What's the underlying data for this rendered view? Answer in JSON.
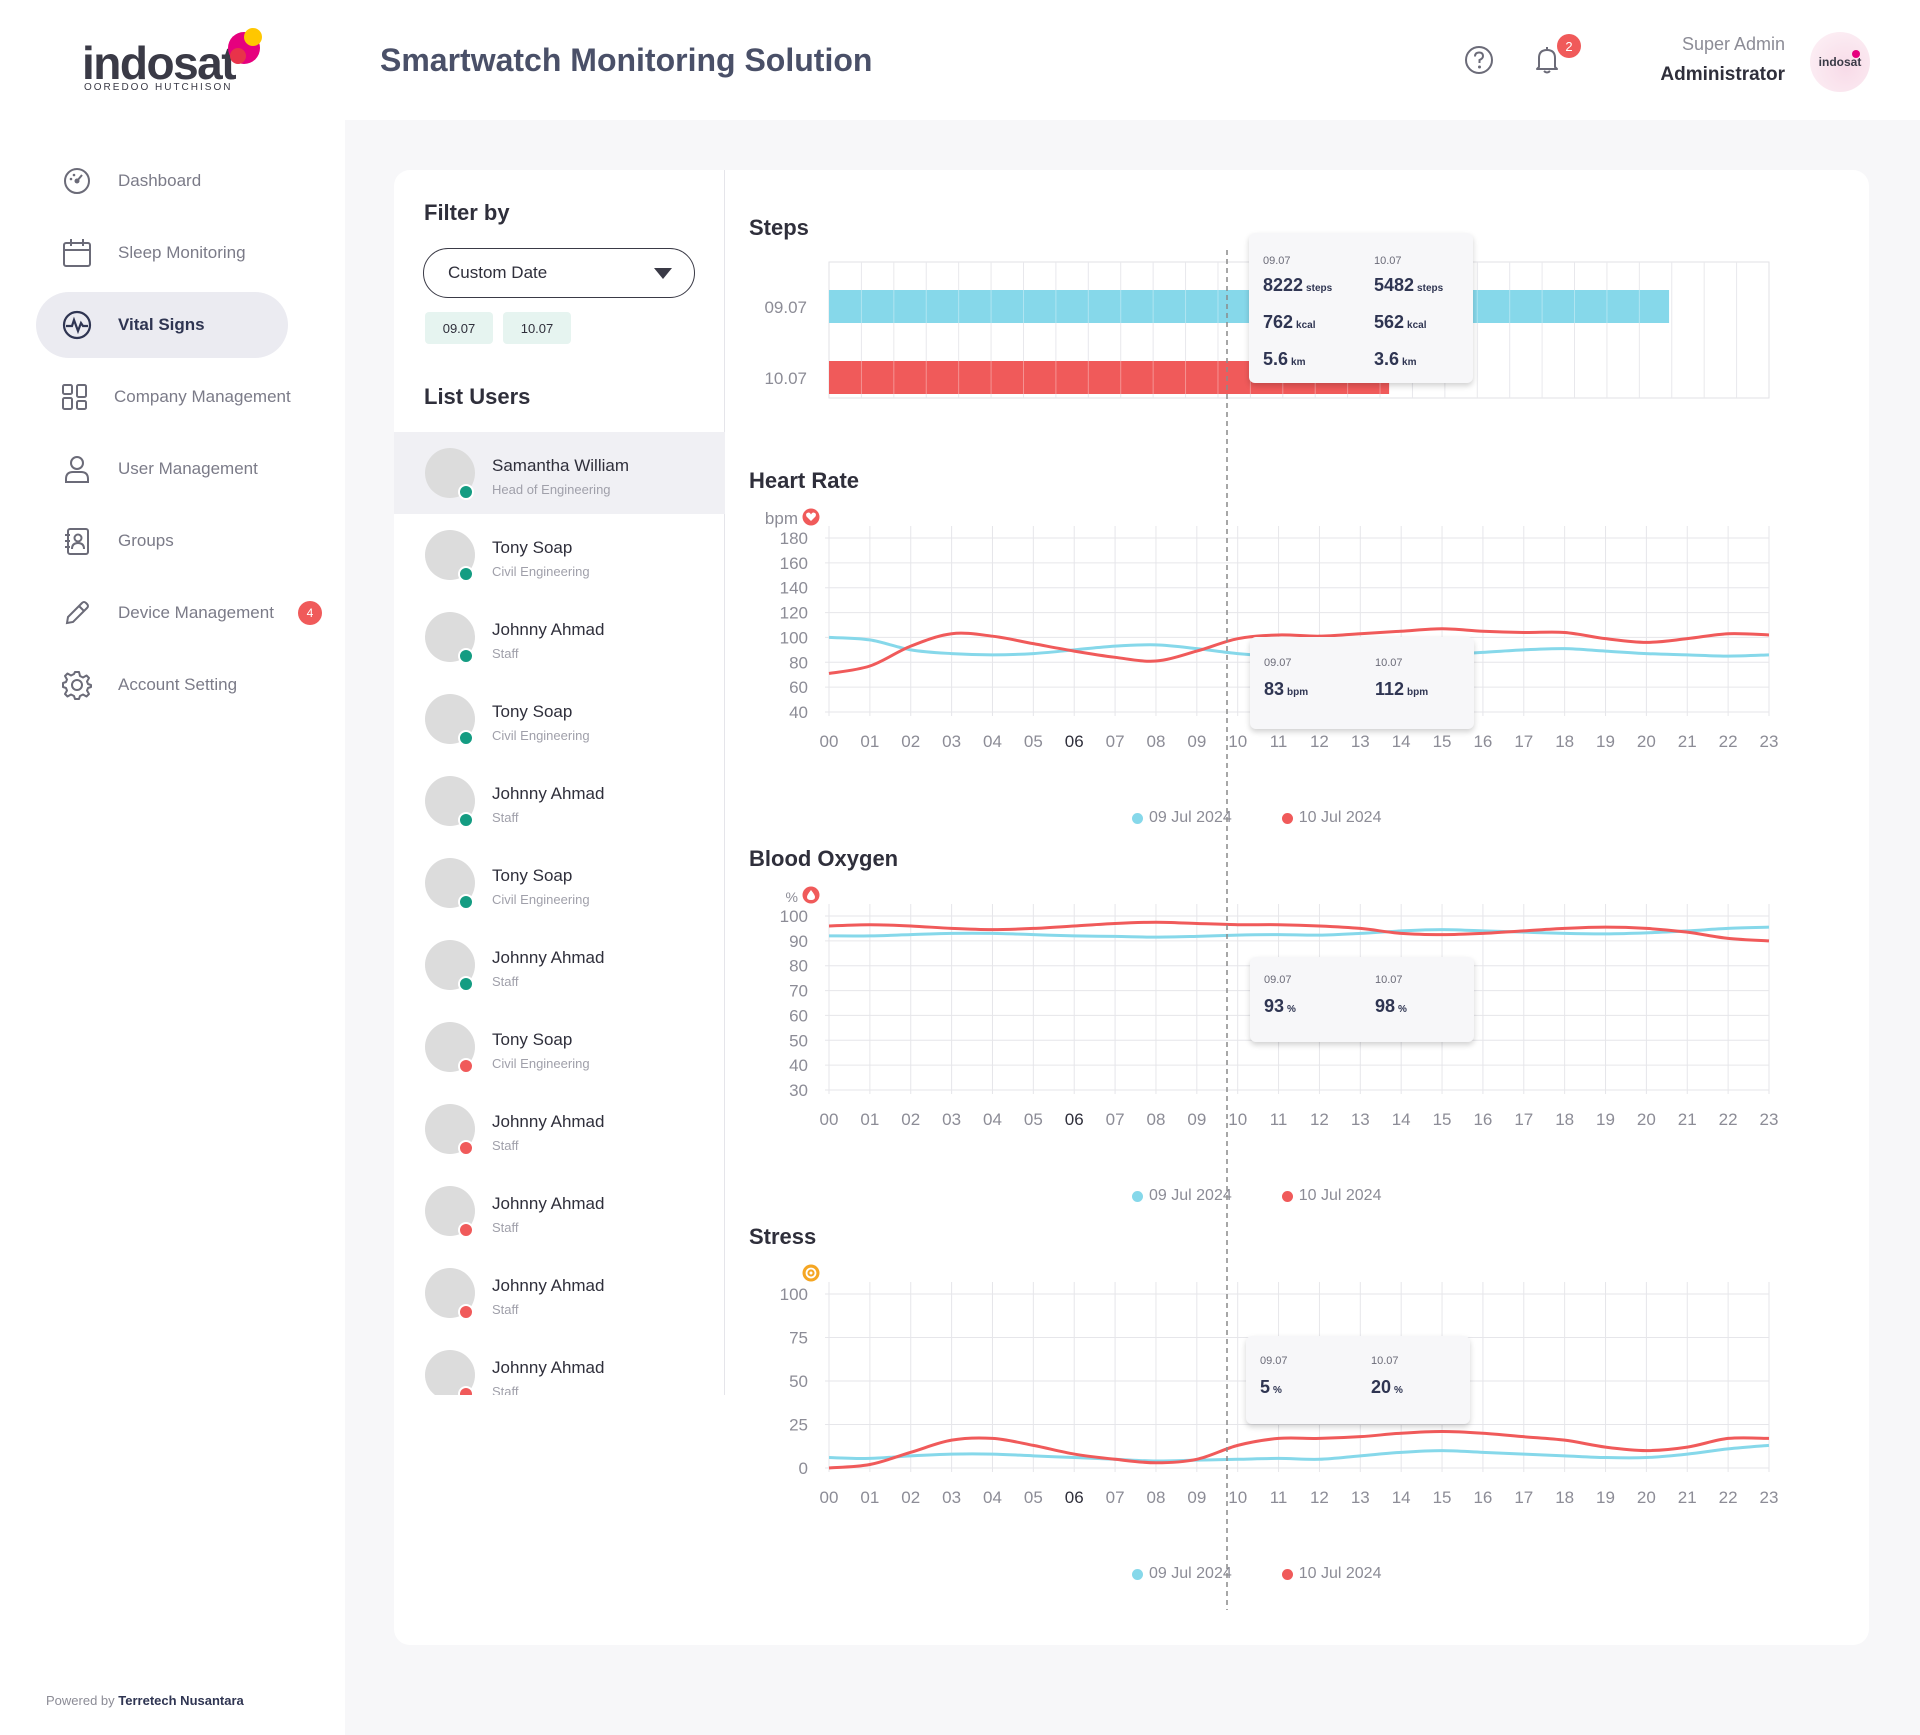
{
  "brand": {
    "logo_word": "indosat",
    "logo_sub": "OOREDOO HUTCHISON",
    "powered_prefix": "Powered by",
    "powered_company": "Terretech Nusantara"
  },
  "header": {
    "title": "Smartwatch Monitoring Solution",
    "notif_count": "2",
    "user_role": "Super Admin",
    "user_name": "Administrator",
    "avatar_text": "indosat"
  },
  "sidebar": {
    "items": [
      {
        "label": "Dashboard",
        "icon": "dashboard-icon"
      },
      {
        "label": "Sleep Monitoring",
        "icon": "calendar-icon"
      },
      {
        "label": "Vital Signs",
        "icon": "pulse-icon",
        "active": true
      },
      {
        "label": "Company Management",
        "icon": "grid-icon"
      },
      {
        "label": "User Management",
        "icon": "user-icon"
      },
      {
        "label": "Groups",
        "icon": "contacts-icon"
      },
      {
        "label": "Device Management",
        "icon": "pencil-icon",
        "badge": "4"
      },
      {
        "label": "Account Setting",
        "icon": "gear-icon"
      }
    ]
  },
  "filter": {
    "title": "Filter by",
    "select_value": "Custom Date",
    "chips": [
      "09.07",
      "10.07"
    ]
  },
  "list_users": {
    "title": "List Users",
    "users": [
      {
        "name": "Samantha William",
        "role": "Head of Engineering",
        "status": "online"
      },
      {
        "name": "Tony Soap",
        "role": "Civil Engineering",
        "status": "online"
      },
      {
        "name": "Johnny Ahmad",
        "role": "Staff",
        "status": "online"
      },
      {
        "name": "Tony Soap",
        "role": "Civil Engineering",
        "status": "online"
      },
      {
        "name": "Johnny Ahmad",
        "role": "Staff",
        "status": "online"
      },
      {
        "name": "Tony Soap",
        "role": "Civil Engineering",
        "status": "online"
      },
      {
        "name": "Johnny Ahmad",
        "role": "Staff",
        "status": "online"
      },
      {
        "name": "Tony Soap",
        "role": "Civil Engineering",
        "status": "offline"
      },
      {
        "name": "Johnny Ahmad",
        "role": "Staff",
        "status": "offline"
      },
      {
        "name": "Johnny Ahmad",
        "role": "Staff",
        "status": "offline"
      },
      {
        "name": "Johnny Ahmad",
        "role": "Staff",
        "status": "offline"
      },
      {
        "name": "Johnny Ahmad",
        "role": "Staff",
        "status": "offline"
      }
    ]
  },
  "colors": {
    "series1": "#86d8ea",
    "series2": "#f05a5a",
    "online": "#149c82",
    "offline": "#f05a5a",
    "accent": "#2f3552"
  },
  "chart_data": [
    {
      "type": "bar",
      "title": "Steps",
      "orientation": "horizontal",
      "categories": [
        "09.07",
        "10.07"
      ],
      "values": [
        8222,
        5482
      ],
      "xlim": [
        0,
        9200
      ],
      "grid": true,
      "tooltip": [
        {
          "date": "09.07",
          "steps": "8222",
          "kcal": "762",
          "km": "5.6"
        },
        {
          "date": "10.07",
          "steps": "5482",
          "kcal": "562",
          "km": "3.6"
        }
      ],
      "tooltip_units": {
        "steps": "steps",
        "kcal": "kcal",
        "km": "km"
      }
    },
    {
      "type": "line",
      "title": "Heart Rate",
      "ylabel": "bpm",
      "yticks": [
        180,
        160,
        140,
        120,
        100,
        80,
        60,
        40
      ],
      "ylim": [
        40,
        180
      ],
      "x": [
        "00",
        "01",
        "02",
        "03",
        "04",
        "05",
        "06",
        "07",
        "08",
        "09",
        "10",
        "11",
        "12",
        "13",
        "14",
        "15",
        "16",
        "17",
        "18",
        "19",
        "20",
        "21",
        "22",
        "23"
      ],
      "highlight_x": "06",
      "series": [
        {
          "name": "09 Jul 2024",
          "values": [
            100,
            98,
            90,
            87,
            86,
            87,
            90,
            93,
            94,
            91,
            87,
            85,
            86,
            85,
            84,
            86,
            88,
            90,
            91,
            89,
            87,
            86,
            85,
            86
          ]
        },
        {
          "name": "10 Jul 2024",
          "values": [
            71,
            77,
            93,
            103,
            101,
            95,
            89,
            84,
            81,
            89,
            99,
            102,
            101,
            103,
            105,
            107,
            105,
            104,
            104,
            99,
            96,
            99,
            103,
            102
          ]
        }
      ],
      "tooltip": [
        {
          "date": "09.07",
          "value": "83"
        },
        {
          "date": "10.07",
          "value": "112"
        }
      ],
      "tooltip_unit": "bpm"
    },
    {
      "type": "line",
      "title": "Blood Oxygen",
      "ylabel": "%",
      "yticks": [
        100,
        90,
        80,
        70,
        60,
        50,
        40,
        30
      ],
      "ylim": [
        30,
        100
      ],
      "x": [
        "00",
        "01",
        "02",
        "03",
        "04",
        "05",
        "06",
        "07",
        "08",
        "09",
        "10",
        "11",
        "12",
        "13",
        "14",
        "15",
        "16",
        "17",
        "18",
        "19",
        "20",
        "21",
        "22",
        "23"
      ],
      "highlight_x": "06",
      "series": [
        {
          "name": "09 Jul 2024",
          "values": [
            92,
            92,
            92.5,
            93,
            93,
            92.5,
            92,
            91.8,
            91.5,
            91.8,
            92.3,
            92.5,
            92.3,
            93,
            94,
            94.5,
            94,
            93.5,
            93,
            92.8,
            93.2,
            94,
            95,
            95.5
          ]
        },
        {
          "name": "10 Jul 2024",
          "values": [
            96,
            96.5,
            96,
            95,
            94.5,
            95,
            96,
            97,
            97.5,
            97,
            96.5,
            96.5,
            96,
            95,
            93,
            92.5,
            93,
            94,
            95,
            95.5,
            95,
            93.5,
            91,
            90
          ]
        }
      ],
      "tooltip": [
        {
          "date": "09.07",
          "value": "93"
        },
        {
          "date": "10.07",
          "value": "98"
        }
      ],
      "tooltip_unit": "%"
    },
    {
      "type": "line",
      "title": "Stress",
      "ylabel": "",
      "yticks": [
        100,
        75,
        50,
        25,
        0
      ],
      "ylim": [
        0,
        100
      ],
      "x": [
        "00",
        "01",
        "02",
        "03",
        "04",
        "05",
        "06",
        "07",
        "08",
        "09",
        "10",
        "11",
        "12",
        "13",
        "14",
        "15",
        "16",
        "17",
        "18",
        "19",
        "20",
        "21",
        "22",
        "23"
      ],
      "highlight_x": "06",
      "series": [
        {
          "name": "09 Jul 2024",
          "values": [
            6,
            5.5,
            7,
            8,
            8,
            7,
            6,
            5,
            4,
            4.5,
            5,
            5.5,
            5,
            7,
            9,
            10,
            9,
            8,
            7,
            6,
            6,
            8,
            11,
            13
          ]
        },
        {
          "name": "10 Jul 2024",
          "values": [
            0,
            2,
            9,
            16,
            17,
            13,
            8,
            5,
            3,
            5,
            13,
            17,
            17,
            18,
            20,
            21,
            20,
            18,
            16,
            12,
            10,
            12,
            17,
            17
          ]
        }
      ],
      "tooltip": [
        {
          "date": "09.07",
          "value": "5"
        },
        {
          "date": "10.07",
          "value": "20"
        }
      ],
      "tooltip_unit": "%"
    }
  ]
}
